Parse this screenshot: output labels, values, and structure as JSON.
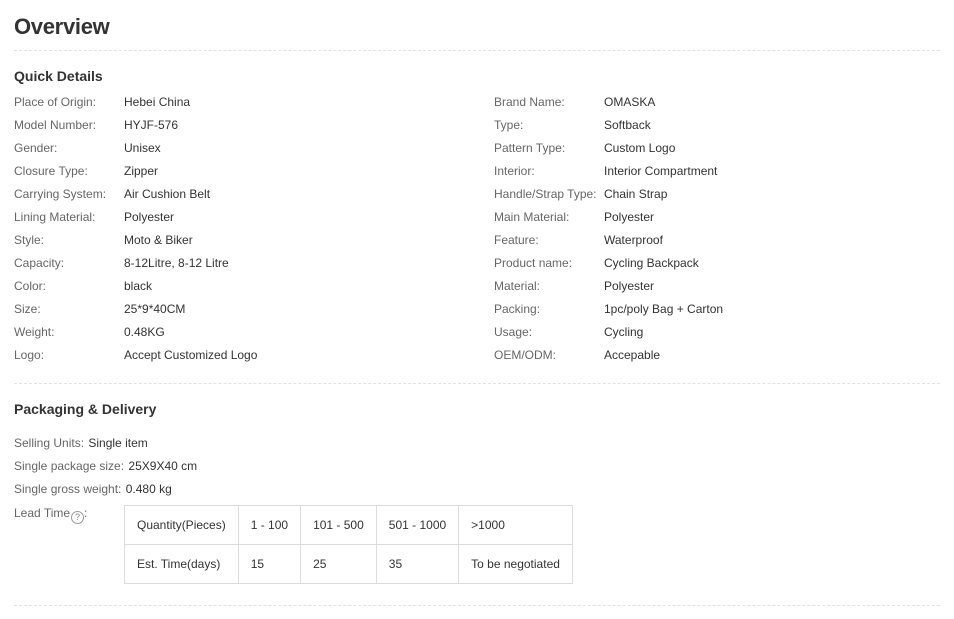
{
  "overview_title": "Overview",
  "quick_details": {
    "title": "Quick Details",
    "left": [
      {
        "key": "Place of Origin:",
        "value": "Hebei China"
      },
      {
        "key": "Model Number:",
        "value": "HYJF-576"
      },
      {
        "key": "Gender:",
        "value": "Unisex"
      },
      {
        "key": "Closure Type:",
        "value": "Zipper"
      },
      {
        "key": "Carrying System:",
        "value": "Air Cushion Belt"
      },
      {
        "key": "Lining Material:",
        "value": "Polyester"
      },
      {
        "key": "Style:",
        "value": "Moto & Biker"
      },
      {
        "key": "Capacity:",
        "value": "8-12Litre, 8-12 Litre"
      },
      {
        "key": "Color:",
        "value": "black"
      },
      {
        "key": "Size:",
        "value": "25*9*40CM"
      },
      {
        "key": "Weight:",
        "value": "0.48KG"
      },
      {
        "key": "Logo:",
        "value": "Accept Customized Logo"
      }
    ],
    "right": [
      {
        "key": "Brand Name:",
        "value": "OMASKA"
      },
      {
        "key": "Type:",
        "value": "Softback"
      },
      {
        "key": "Pattern Type:",
        "value": "Custom Logo"
      },
      {
        "key": "Interior:",
        "value": "Interior Compartment"
      },
      {
        "key": "Handle/Strap Type:",
        "value": "Chain Strap"
      },
      {
        "key": "Main Material:",
        "value": "Polyester"
      },
      {
        "key": "Feature:",
        "value": "Waterproof"
      },
      {
        "key": "Product name:",
        "value": "Cycling Backpack"
      },
      {
        "key": "Material:",
        "value": "Polyester"
      },
      {
        "key": "Packing:",
        "value": "1pc/poly Bag + Carton"
      },
      {
        "key": "Usage:",
        "value": "Cycling"
      },
      {
        "key": "OEM/ODM:",
        "value": "Accepable"
      }
    ]
  },
  "packaging": {
    "title": "Packaging & Delivery",
    "rows": [
      {
        "key": "Selling Units:",
        "value": "Single item"
      },
      {
        "key": "Single package size:",
        "value": "25X9X40 cm"
      },
      {
        "key": "Single gross weight:",
        "value": "0.480 kg"
      }
    ],
    "lead_time_label": "Lead Time",
    "help_icon": "question-circle-icon",
    "lead_table": {
      "header": [
        "Quantity(Pieces)",
        "1 - 100",
        "101 - 500",
        "501 - 1000",
        ">1000"
      ],
      "row": [
        "Est. Time(days)",
        "15",
        "25",
        "35",
        "To be negotiated"
      ]
    }
  }
}
